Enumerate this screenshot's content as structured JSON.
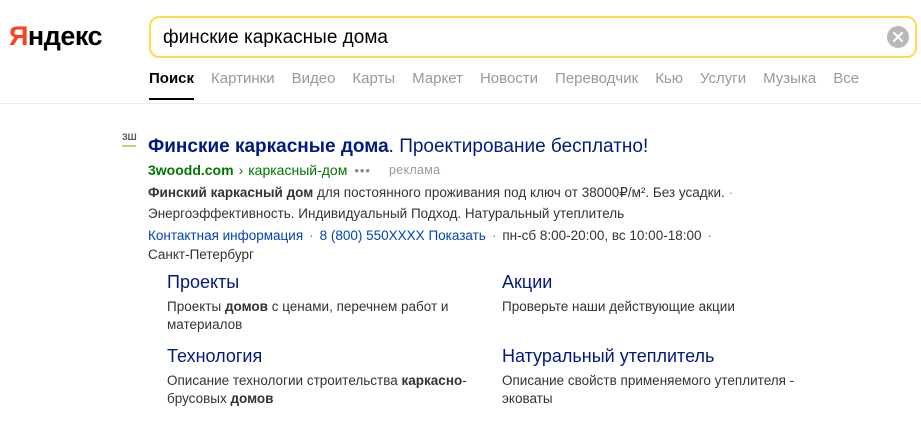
{
  "logo": {
    "first_letter": "Я",
    "rest": "ндекс"
  },
  "search": {
    "query": "финские каркасные дома"
  },
  "tabs": [
    {
      "label": "Поиск"
    },
    {
      "label": "Картинки"
    },
    {
      "label": "Видео"
    },
    {
      "label": "Карты"
    },
    {
      "label": "Маркет"
    },
    {
      "label": "Новости"
    },
    {
      "label": "Переводчик"
    },
    {
      "label": "Кью"
    },
    {
      "label": "Услуги"
    },
    {
      "label": "Музыка"
    },
    {
      "label": "Все"
    }
  ],
  "result": {
    "favicon_text": "ЗШ",
    "title_bold": "Финские каркасные дома",
    "title_rest": ". Проектирование бесплатно!",
    "domain": "3woodd.com",
    "url_sep": "›",
    "path": "каркасный-дом",
    "dots": "•••",
    "ad_label": "реклама",
    "snippet_bold": "Финский каркасный дом",
    "snippet_line1": " для постоянного проживания под ключ от 38000₽/м². Без усадки.",
    "snippet_line2": "Энергоэффективность. Индивидуальный Подход. Натуральный утеплитель",
    "contact_info": "Контактная информация",
    "phone": "8 (800) 550XXXX Показать",
    "hours": "пн-сб 8:00-20:00, вс 10:00-18:00",
    "city": "Санкт-Петербург",
    "sitelinks": [
      {
        "title": "Проекты",
        "desc_a": "Проекты ",
        "desc_b": "домов",
        "desc_c": " с ценами, перечнем работ и материалов"
      },
      {
        "title": "Акции",
        "desc_a": "Проверьте наши действующие акции",
        "desc_b": "",
        "desc_c": ""
      },
      {
        "title": "Технология",
        "desc_a": "Описание технологии строительства ",
        "desc_b": "каркасно",
        "desc_c": "-брусовых ",
        "desc_d": "домов"
      },
      {
        "title": "Натуральный утеплитель",
        "desc_a": "Описание свойств применяемого утеплителя - эковаты",
        "desc_b": "",
        "desc_c": ""
      }
    ]
  },
  "colors": {
    "accent_yellow": "#ffdb4d",
    "logo_red": "#fc3f1d",
    "link_blue": "#001a80",
    "url_green": "#007700"
  }
}
